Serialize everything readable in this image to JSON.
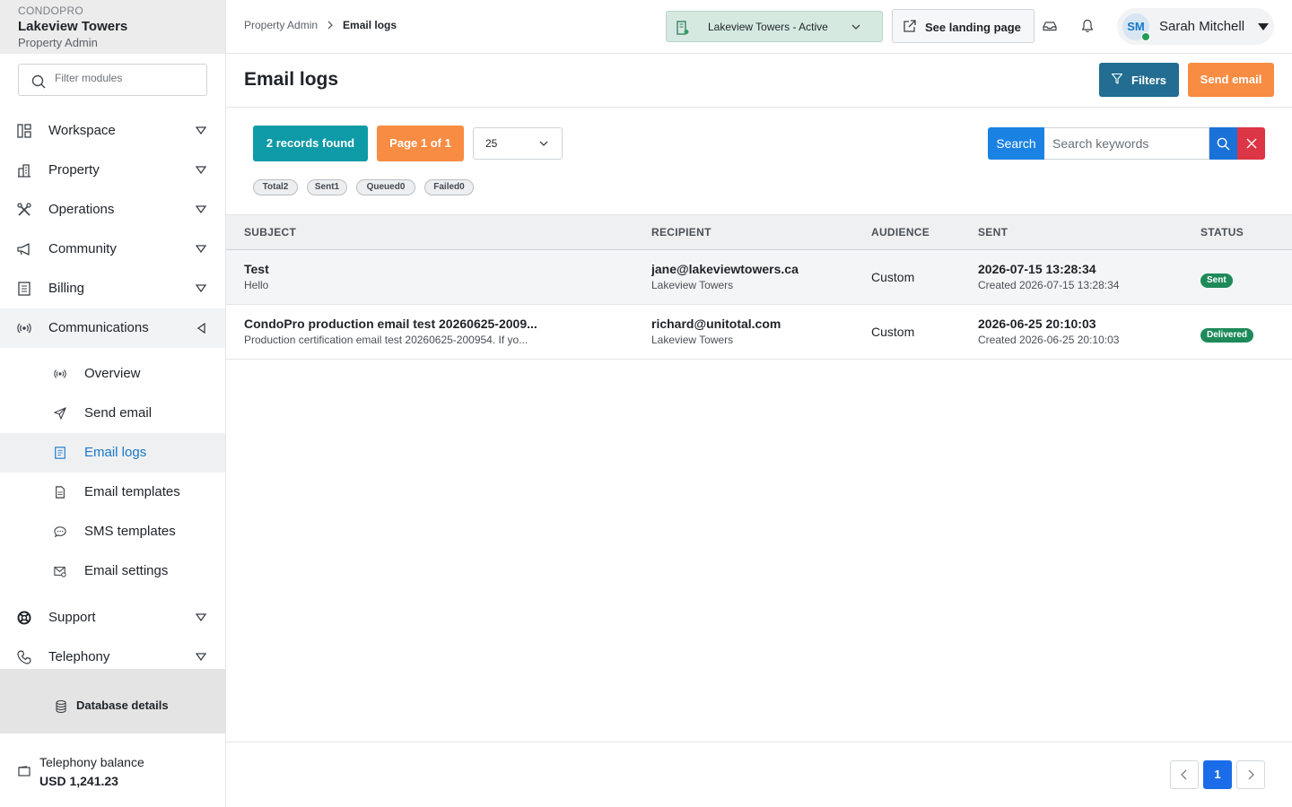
{
  "brand": {
    "org": "CONDOPRO",
    "name": "Lakeview Towers",
    "role": "Property Admin"
  },
  "filter": {
    "placeholder": "Filter modules"
  },
  "nav": {
    "items": [
      {
        "label": "Workspace",
        "icon": "layout-icon"
      },
      {
        "label": "Property",
        "icon": "building-icon"
      },
      {
        "label": "Operations",
        "icon": "tools-icon"
      },
      {
        "label": "Community",
        "icon": "megaphone-icon"
      },
      {
        "label": "Billing",
        "icon": "receipt-icon"
      },
      {
        "label": "Communications",
        "icon": "broadcast-icon"
      },
      {
        "label": "Support",
        "icon": "lifebuoy-icon"
      },
      {
        "label": "Telephony",
        "icon": "phone-icon"
      }
    ],
    "sub_items": [
      {
        "label": "Overview",
        "icon": "broadcast-icon"
      },
      {
        "label": "Send email",
        "icon": "send-icon"
      },
      {
        "label": "Email logs",
        "icon": "log-icon"
      },
      {
        "label": "Email templates",
        "icon": "document-icon"
      },
      {
        "label": "SMS templates",
        "icon": "chat-icon"
      },
      {
        "label": "Email settings",
        "icon": "mail-settings-icon"
      }
    ],
    "database_details": "Database details",
    "balance_label": "Telephony balance",
    "balance_value": "USD 1,241.23"
  },
  "header": {
    "breadcrumb": [
      "Property Admin",
      "Email logs"
    ],
    "property_select": "Lakeview Towers - Active",
    "landing_button": "See landing page",
    "user": {
      "initials": "SM",
      "name": "Sarah Mitchell"
    }
  },
  "page": {
    "title": "Email logs",
    "filters_button": "Filters",
    "send_email_button": "Send email"
  },
  "toolbar": {
    "records_found": "2 records found",
    "page_info": "Page 1 of 1",
    "page_size": "25",
    "search_label": "Search",
    "search_placeholder": "Search keywords"
  },
  "stats": [
    {
      "label": "Total",
      "count": "2"
    },
    {
      "label": "Sent",
      "count": "1"
    },
    {
      "label": "Queued",
      "count": "0"
    },
    {
      "label": "Failed",
      "count": "0"
    }
  ],
  "table": {
    "columns": [
      "SUBJECT",
      "RECIPIENT",
      "AUDIENCE",
      "SENT",
      "STATUS"
    ],
    "rows": [
      {
        "subject": "Test",
        "preview": "Hello",
        "recipient": "jane@lakeviewtowers.ca",
        "recipient_org": "Lakeview Towers",
        "audience": "Custom",
        "sent": "2026-07-15 13:28:34",
        "created": "Created 2026-07-15 13:28:34",
        "status": "Sent"
      },
      {
        "subject": "CondoPro production email test 20260625-2009...",
        "preview": "Production certification email test 20260625-200954. If yo...",
        "recipient": "richard@unitotal.com",
        "recipient_org": "Lakeview Towers",
        "audience": "Custom",
        "sent": "2026-06-25 20:10:03",
        "created": "Created 2026-06-25 20:10:03",
        "status": "Delivered"
      }
    ]
  },
  "pagination": {
    "current": "1"
  },
  "colors": {
    "primary_blue": "#1a82e2",
    "teal": "#0e9aa7",
    "orange": "#f88c42",
    "filters_blue": "#226d91",
    "success_green": "#1e8a5a",
    "danger_red": "#dc3545",
    "active_link": "#1677c9"
  }
}
